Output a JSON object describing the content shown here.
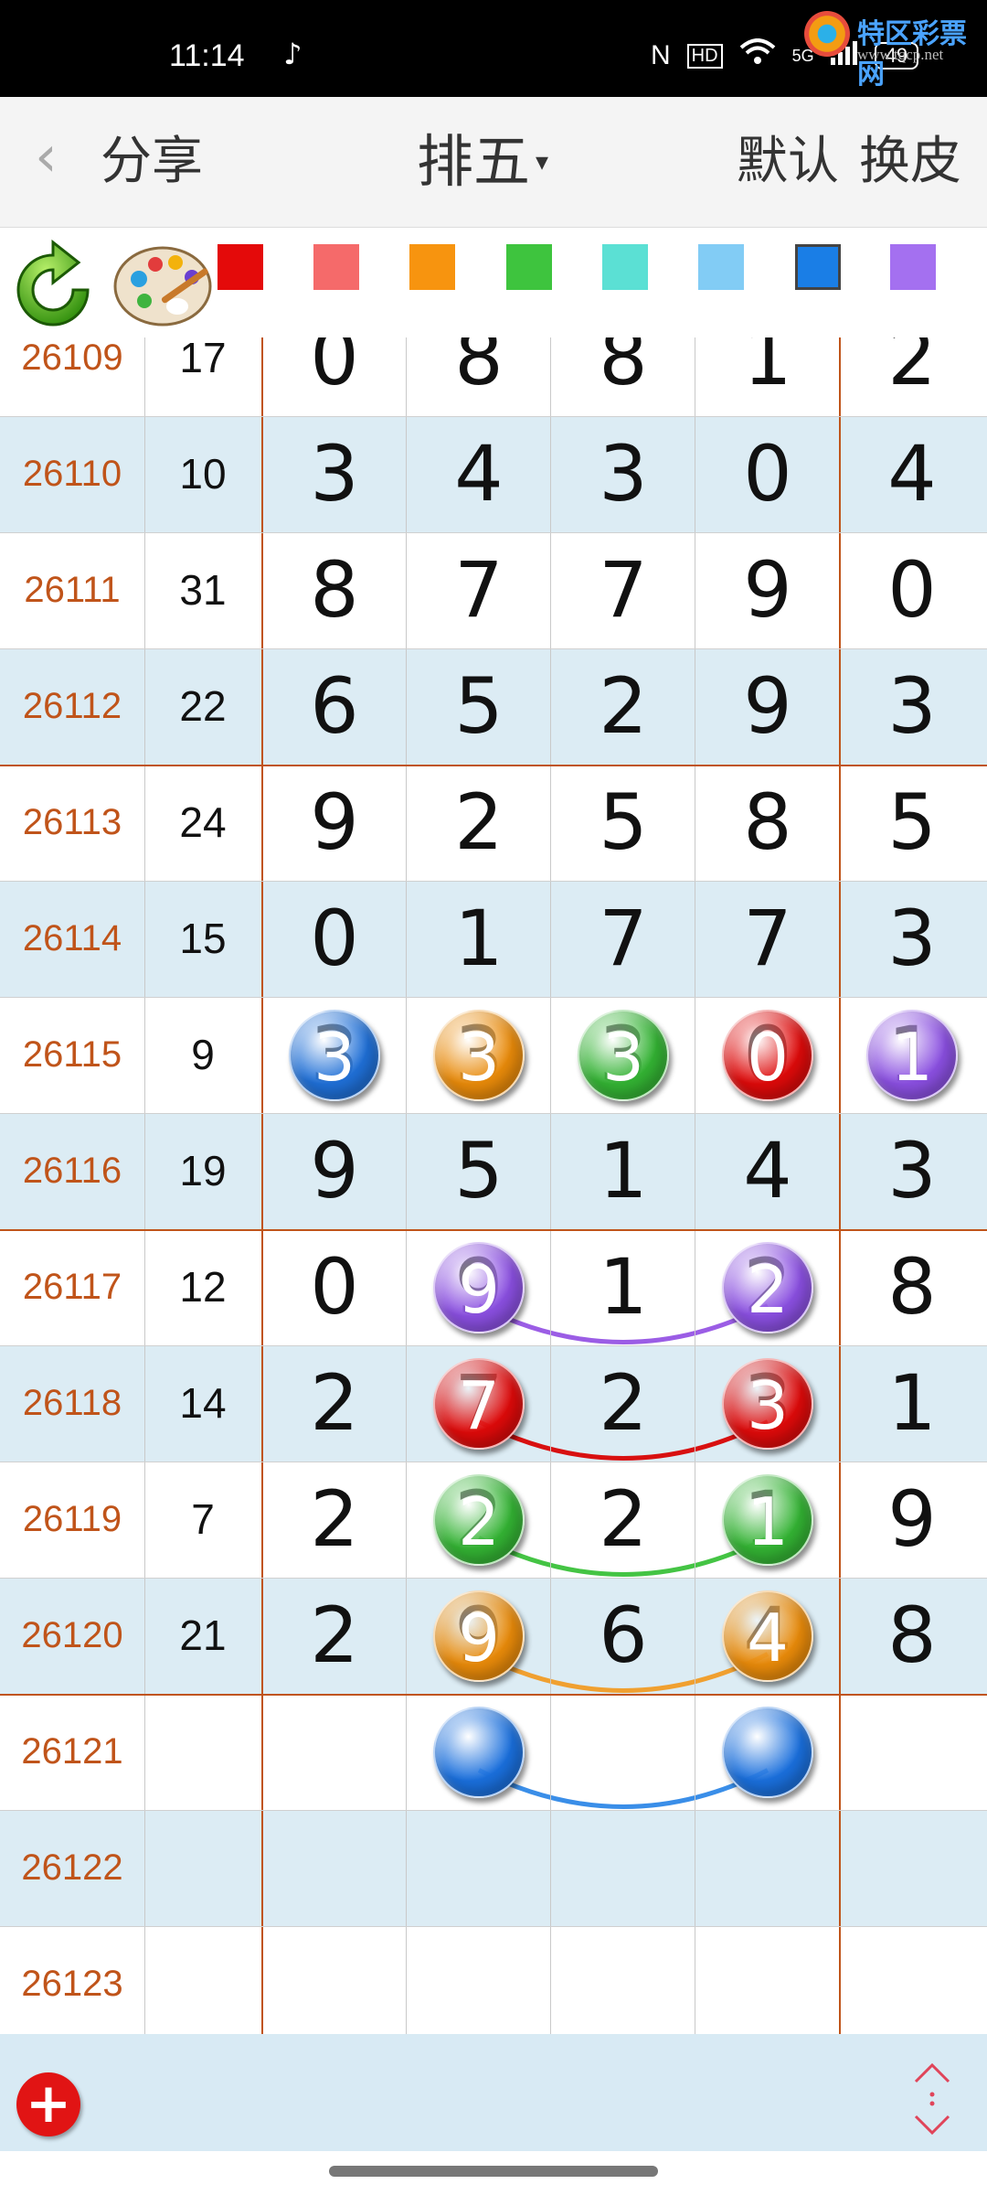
{
  "status_bar": {
    "time": "11:14",
    "tiktok_icon": "tiktok-icon",
    "nfc": "N",
    "hd": "HD",
    "network": "5G",
    "battery": "49",
    "watermark_title": "特区彩票网",
    "watermark_url": "www.tqcp.net"
  },
  "nav": {
    "back_icon": "chevron-left-icon",
    "share_label": "分享",
    "title": "排五",
    "title_caret": "▾",
    "default_label": "默认",
    "skin_label": "换皮"
  },
  "toolbar": {
    "refresh_icon": "refresh-icon",
    "palette_icon": "palette-icon",
    "swatches": [
      "#e40a0a",
      "#f56a6a",
      "#f7940f",
      "#3ec43e",
      "#5be0d4",
      "#82ccf5",
      "#1a7ee6",
      "#a470f0"
    ],
    "selected_swatch": 6
  },
  "rows": [
    {
      "issue": "26109",
      "sum": "17",
      "digits": [
        "0",
        "8",
        "8",
        "1",
        "2"
      ]
    },
    {
      "issue": "26110",
      "sum": "10",
      "digits": [
        "3",
        "4",
        "3",
        "0",
        "4"
      ]
    },
    {
      "issue": "26111",
      "sum": "31",
      "digits": [
        "8",
        "7",
        "7",
        "9",
        "0"
      ]
    },
    {
      "issue": "26112",
      "sum": "22",
      "digits": [
        "6",
        "5",
        "2",
        "9",
        "3"
      ]
    },
    {
      "issue": "26113",
      "sum": "24",
      "digits": [
        "9",
        "2",
        "5",
        "8",
        "5"
      ]
    },
    {
      "issue": "26114",
      "sum": "15",
      "digits": [
        "0",
        "1",
        "7",
        "7",
        "3"
      ]
    },
    {
      "issue": "26115",
      "sum": "9",
      "digits": [
        "3",
        "3",
        "3",
        "0",
        "1"
      ]
    },
    {
      "issue": "26116",
      "sum": "19",
      "digits": [
        "9",
        "5",
        "1",
        "4",
        "3"
      ]
    },
    {
      "issue": "26117",
      "sum": "12",
      "digits": [
        "0",
        "9",
        "1",
        "2",
        "8"
      ]
    },
    {
      "issue": "26118",
      "sum": "14",
      "digits": [
        "2",
        "7",
        "2",
        "3",
        "1"
      ]
    },
    {
      "issue": "26119",
      "sum": "7",
      "digits": [
        "2",
        "2",
        "2",
        "1",
        "9"
      ]
    },
    {
      "issue": "26120",
      "sum": "21",
      "digits": [
        "2",
        "9",
        "6",
        "4",
        "8"
      ]
    },
    {
      "issue": "26121",
      "sum": "",
      "digits": [
        "",
        "",
        "",
        "",
        ""
      ]
    },
    {
      "issue": "26122",
      "sum": "",
      "digits": [
        "",
        "",
        "",
        "",
        ""
      ]
    },
    {
      "issue": "26123",
      "sum": "",
      "digits": [
        "",
        "",
        "",
        "",
        ""
      ]
    }
  ],
  "marks": [
    {
      "row": 6,
      "col": 0,
      "color": "#1f6fd6",
      "text": "3"
    },
    {
      "row": 6,
      "col": 1,
      "color": "#e88a0a",
      "text": "3"
    },
    {
      "row": 6,
      "col": 2,
      "color": "#33b233",
      "text": "3"
    },
    {
      "row": 6,
      "col": 3,
      "color": "#dd0a0a",
      "text": "0"
    },
    {
      "row": 6,
      "col": 4,
      "color": "#8a4fe0",
      "text": "1"
    },
    {
      "row": 8,
      "col": 1,
      "color": "#8a4fe0",
      "text": "9"
    },
    {
      "row": 8,
      "col": 3,
      "color": "#8a4fe0",
      "text": "2"
    },
    {
      "row": 9,
      "col": 1,
      "color": "#dd0a0a",
      "text": "7"
    },
    {
      "row": 9,
      "col": 3,
      "color": "#dd0a0a",
      "text": "3"
    },
    {
      "row": 10,
      "col": 1,
      "color": "#33b233",
      "text": "2"
    },
    {
      "row": 10,
      "col": 3,
      "color": "#33b233",
      "text": "1"
    },
    {
      "row": 11,
      "col": 1,
      "color": "#e88a0a",
      "text": "9"
    },
    {
      "row": 11,
      "col": 3,
      "color": "#e88a0a",
      "text": "4"
    },
    {
      "row": 12,
      "col": 1,
      "color": "#1a6fdc",
      "text": ""
    },
    {
      "row": 12,
      "col": 3,
      "color": "#1a6fdc",
      "text": ""
    }
  ],
  "arcs": [
    {
      "row": 8,
      "from_col": 1,
      "to_col": 3,
      "color": "#9b5de5"
    },
    {
      "row": 9,
      "from_col": 1,
      "to_col": 3,
      "color": "#d81010"
    },
    {
      "row": 10,
      "from_col": 1,
      "to_col": 3,
      "color": "#44c444"
    },
    {
      "row": 11,
      "from_col": 1,
      "to_col": 3,
      "color": "#f0a030"
    },
    {
      "row": 12,
      "from_col": 1,
      "to_col": 3,
      "color": "#3a8ee8"
    }
  ],
  "bottom_bar": {
    "add_icon": "add-circle-icon",
    "add_symbol": "+",
    "scroll_icon": "vertical-scroll-arrows-icon",
    "scroll_symbol": "⇅"
  }
}
